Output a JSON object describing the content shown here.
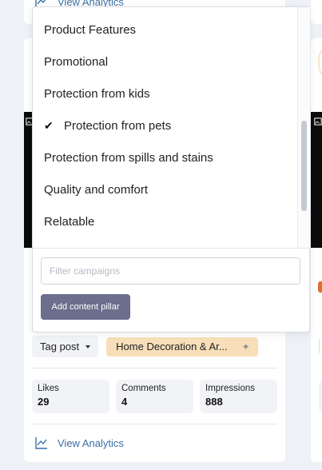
{
  "top_card": {
    "analytics_link": "View Analytics"
  },
  "dropdown": {
    "options": [
      {
        "label": "Product Features",
        "checked": false
      },
      {
        "label": "Promotional",
        "checked": false
      },
      {
        "label": "Protection from kids",
        "checked": false
      },
      {
        "label": "Protection from pets",
        "checked": true
      },
      {
        "label": "Protection from spills and stains",
        "checked": false
      },
      {
        "label": "Quality and comfort",
        "checked": false
      },
      {
        "label": "Relatable",
        "checked": false
      }
    ],
    "check_glyph": "✔",
    "filter_placeholder": "Filter campaigns",
    "filter_value": "",
    "add_button": "Add content pillar"
  },
  "post": {
    "tag_button": "Tag post",
    "pillar_chip": "Home Decoration & Ar...",
    "stats": [
      {
        "label": "Likes",
        "value": "29"
      },
      {
        "label": "Comments",
        "value": "4"
      },
      {
        "label": "Impressions",
        "value": "888"
      }
    ],
    "analytics_link": "View Analytics"
  },
  "colors": {
    "accent_link": "#3a6ea5",
    "chip_bg": "#f8dfb9",
    "button_bg": "#6b6e8c"
  },
  "icons": {
    "analytics": "line-chart-icon",
    "image": "image-icon",
    "sparkle": "sparkle-icon",
    "check": "check-icon"
  }
}
